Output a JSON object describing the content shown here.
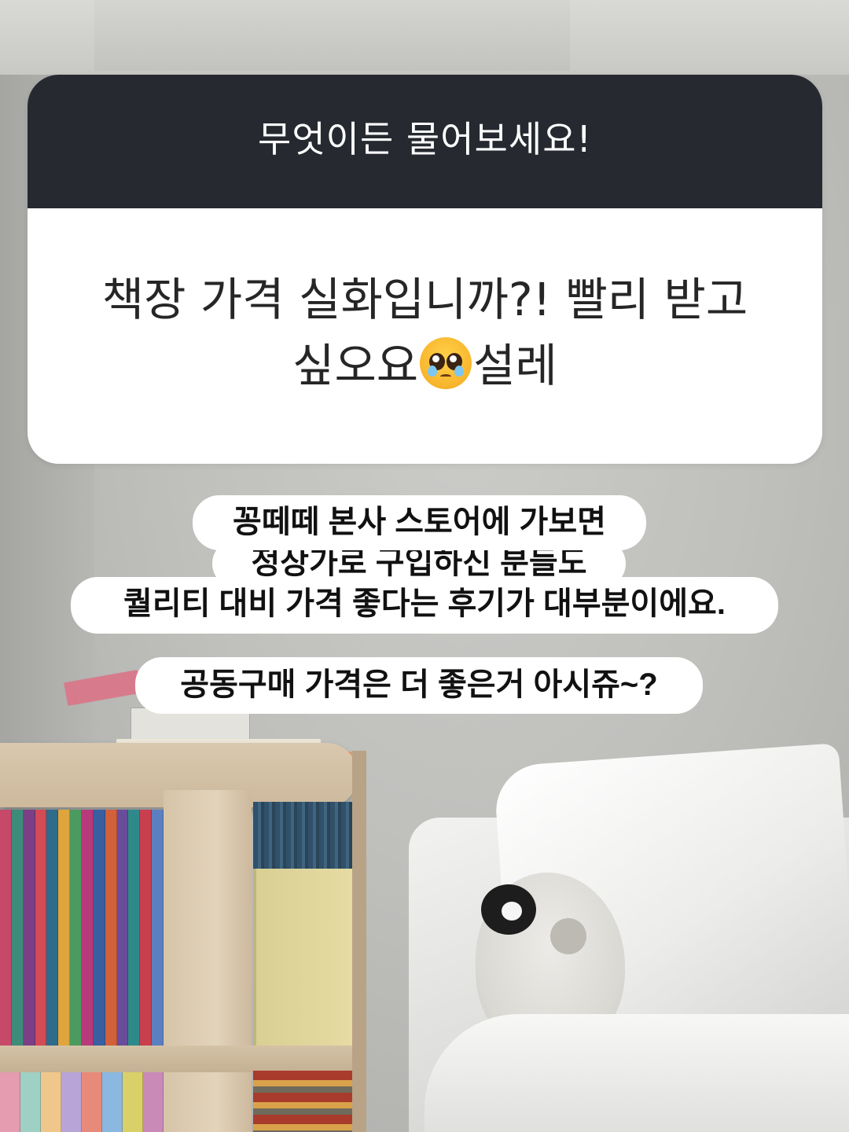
{
  "question_sticker": {
    "title": "무엇이든 물어보세요!",
    "question_line1": "책장 가격 실화입니까?! 빨리 받고",
    "question_line2_before": "싶오요",
    "question_emoji": "pleading-face-emoji",
    "question_line2_after": "설레",
    "header_color": "#262a30",
    "body_color": "#ffffff"
  },
  "captions": {
    "line1": "꽁떼떼 본사 스토어에 가보면",
    "line2": "정상가로 구입하신 분들도",
    "line3": "퀄리티 대비 가격 좋다는 후기가 대부분이에요.",
    "line4": "공동구매 가격은 더 좋은거 아시쥬~?"
  },
  "background": {
    "scene": "bedroom-bookshelf-bed-photo"
  }
}
